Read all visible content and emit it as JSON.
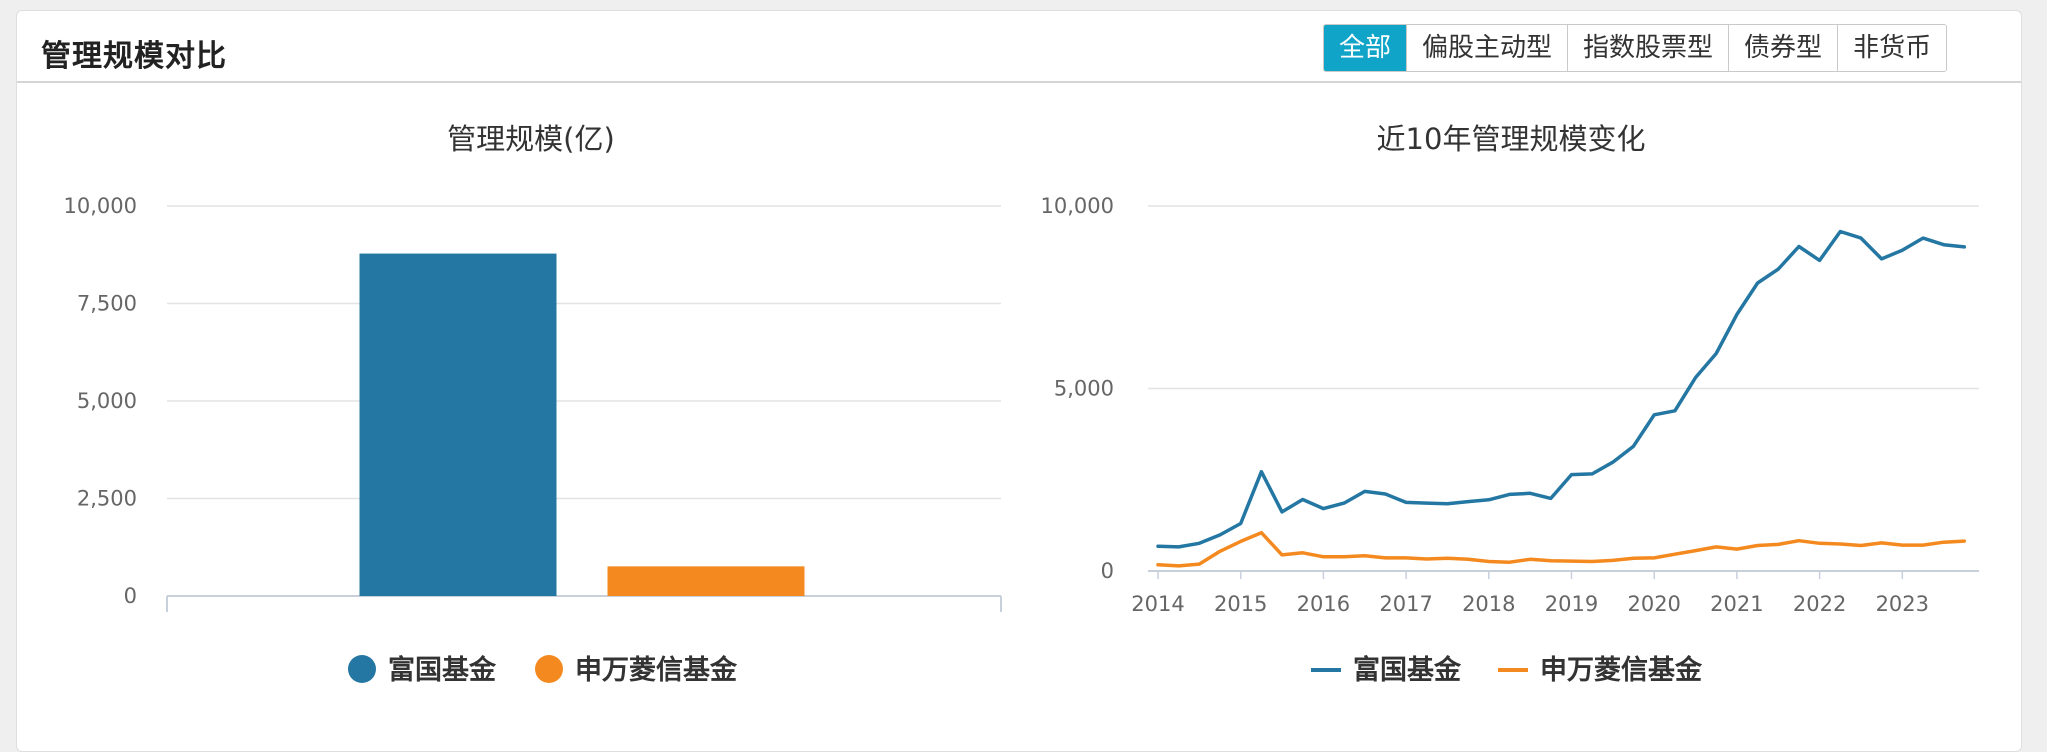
{
  "panel": {
    "title": "管理规模对比",
    "tabs": [
      {
        "label": "全部",
        "active": true
      },
      {
        "label": "偏股主动型",
        "active": false
      },
      {
        "label": "指数股票型",
        "active": false
      },
      {
        "label": "债券型",
        "active": false
      },
      {
        "label": "非货币",
        "active": false
      }
    ]
  },
  "colors": {
    "tab_active": "#10a5c8",
    "series_1": "#2477a2",
    "series_2": "#f48a1f",
    "grid": "#e3e3e3",
    "axis": "#c8d0dc"
  },
  "chart_data": [
    {
      "type": "bar",
      "title": "管理规模(亿)",
      "categories": [
        "富国基金",
        "申万菱信基金"
      ],
      "values": [
        8780,
        760
      ],
      "ylim": [
        0,
        10000
      ],
      "yticks": [
        "0",
        "2,500",
        "5,000",
        "7,500",
        "10,000"
      ],
      "legend": [
        "富国基金",
        "申万菱信基金"
      ],
      "legend_position": "bottom",
      "grid": true
    },
    {
      "type": "line",
      "title": "近10年管理规模变化",
      "xlim": [
        2014,
        2024
      ],
      "ylim": [
        0,
        10000
      ],
      "xticks": [
        "2014",
        "2015",
        "2016",
        "2017",
        "2018",
        "2019",
        "2020",
        "2021",
        "2022",
        "2023"
      ],
      "yticks": [
        "0",
        "5,000",
        "10,000"
      ],
      "x": [
        2014.0,
        2014.25,
        2014.5,
        2014.75,
        2015.0,
        2015.25,
        2015.5,
        2015.75,
        2016.0,
        2016.25,
        2016.5,
        2016.75,
        2017.0,
        2017.25,
        2017.5,
        2017.75,
        2018.0,
        2018.25,
        2018.5,
        2018.75,
        2019.0,
        2019.25,
        2019.5,
        2019.75,
        2020.0,
        2020.25,
        2020.5,
        2020.75,
        2021.0,
        2021.25,
        2021.5,
        2021.75,
        2022.0,
        2022.25,
        2022.5,
        2022.75,
        2023.0,
        2023.25,
        2023.5,
        2023.75
      ],
      "series": [
        {
          "name": "富国基金",
          "values": [
            680,
            660,
            760,
            990,
            1300,
            2720,
            1620,
            1960,
            1710,
            1860,
            2180,
            2110,
            1880,
            1860,
            1840,
            1900,
            1950,
            2100,
            2130,
            1990,
            2640,
            2660,
            2980,
            3420,
            4280,
            4390,
            5300,
            5960,
            7030,
            7890,
            8270,
            8890,
            8510,
            9300,
            9120,
            8550,
            8790,
            9120,
            8940,
            8880
          ]
        },
        {
          "name": "申万菱信基金",
          "values": [
            170,
            140,
            190,
            540,
            810,
            1050,
            440,
            500,
            390,
            390,
            420,
            360,
            360,
            330,
            350,
            320,
            260,
            240,
            320,
            280,
            270,
            260,
            290,
            350,
            360,
            460,
            560,
            660,
            600,
            700,
            730,
            830,
            760,
            740,
            700,
            770,
            710,
            710,
            790,
            820
          ]
        }
      ],
      "legend": [
        "富国基金",
        "申万菱信基金"
      ],
      "legend_position": "bottom",
      "grid": true
    }
  ]
}
